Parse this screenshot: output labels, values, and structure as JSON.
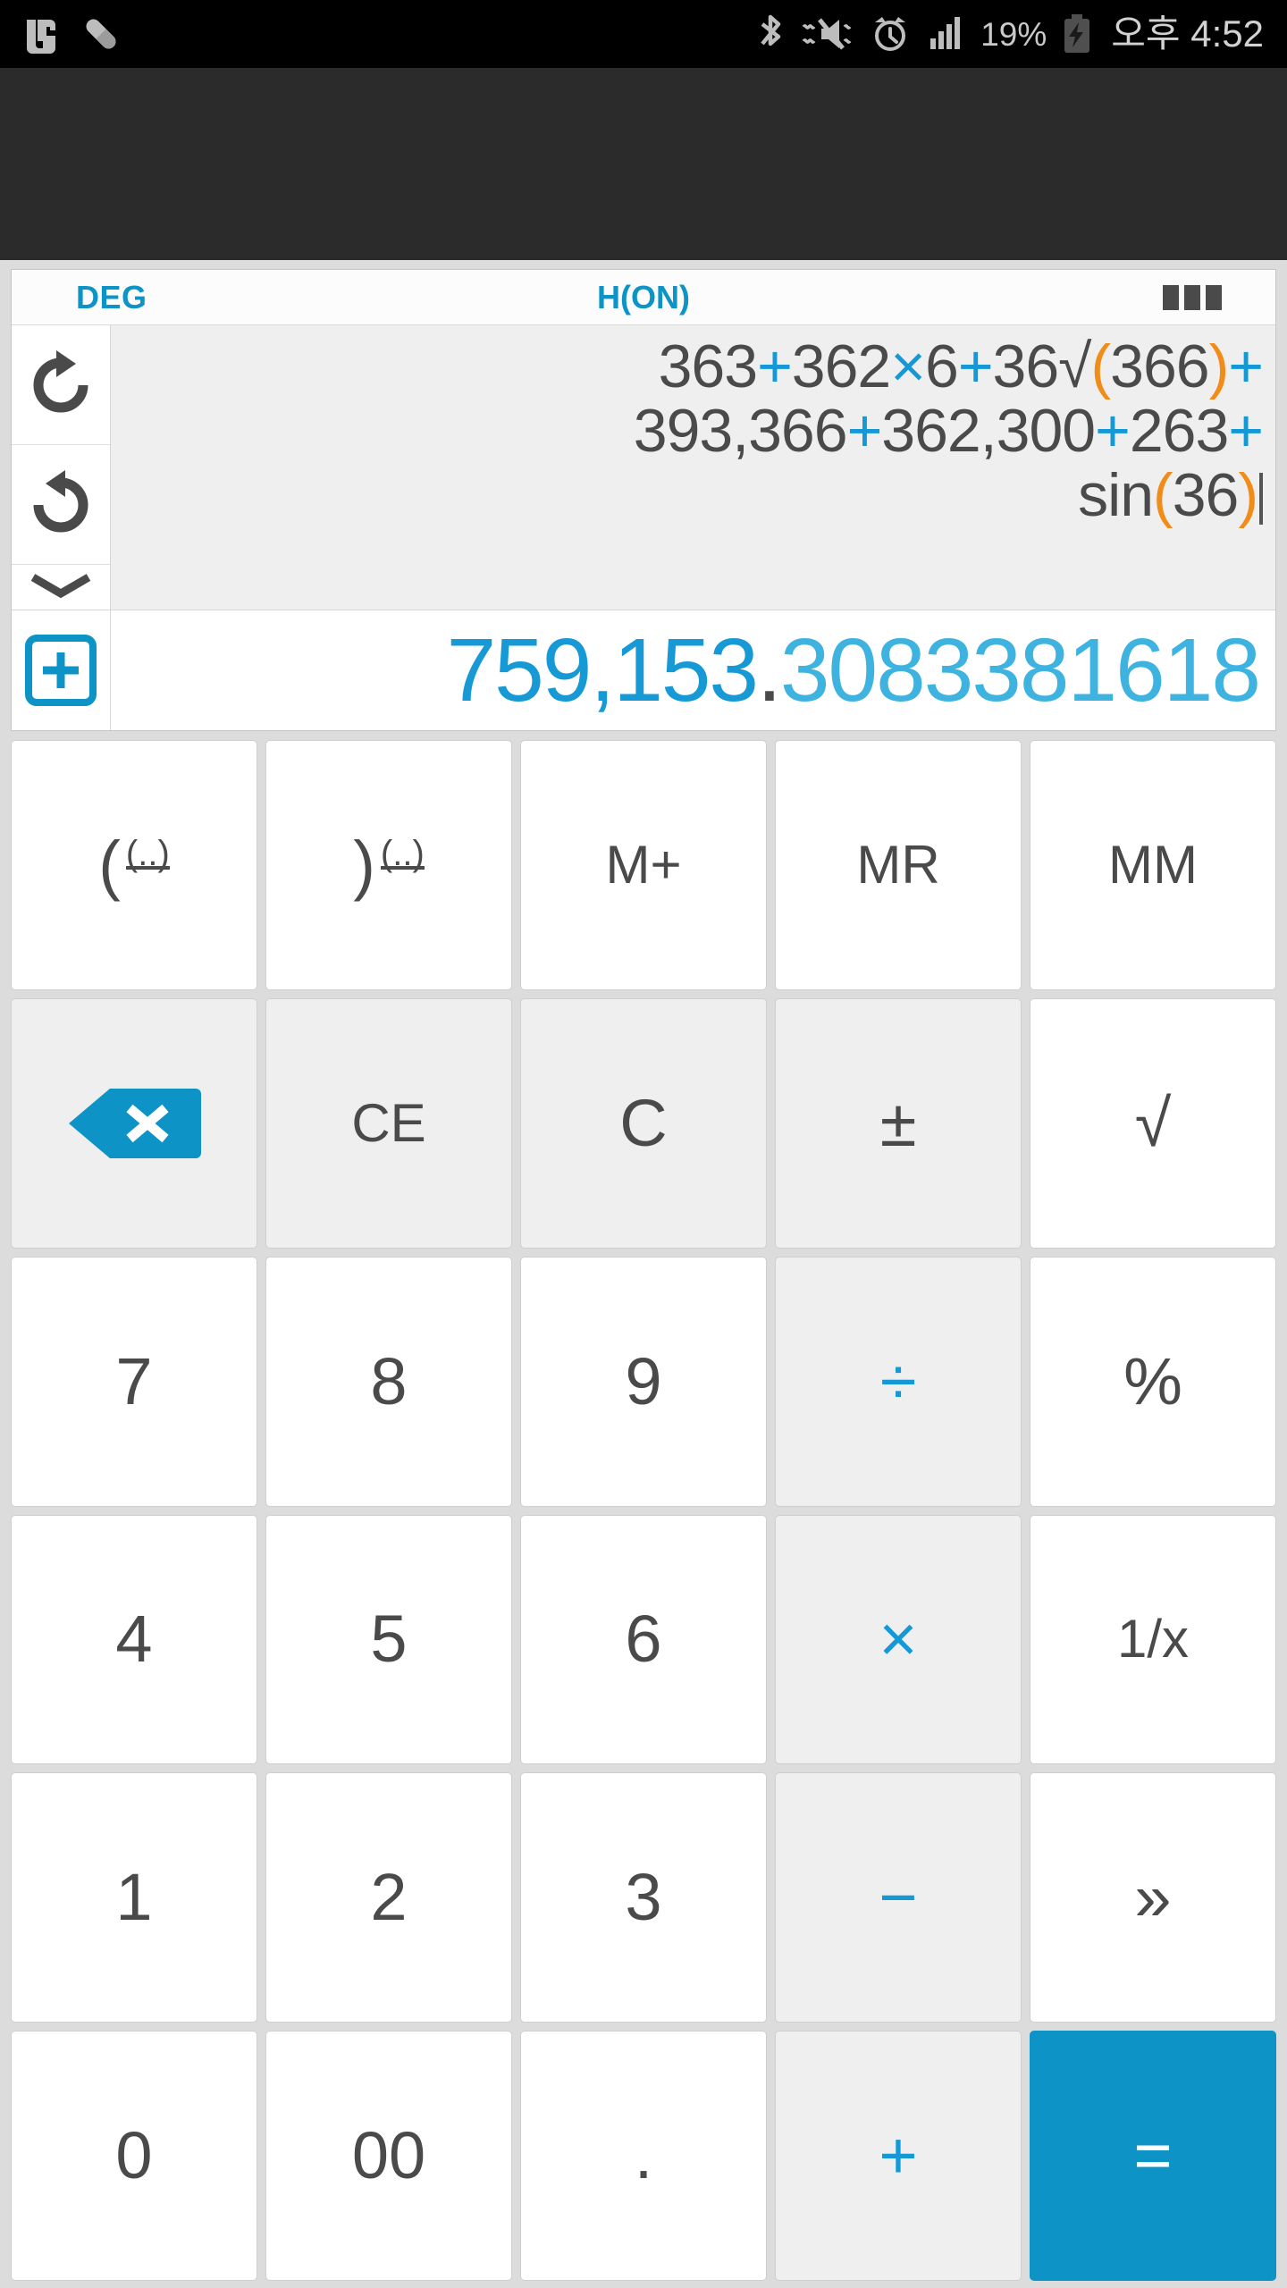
{
  "status_bar": {
    "left_icons": [
      "app-notification-icon",
      "capsule-icon"
    ],
    "right_icons": [
      "bluetooth-icon",
      "vibrate-mute-icon",
      "alarm-icon",
      "signal-bars-icon"
    ],
    "battery_percent": "19%",
    "battery_icon": "battery-charging-icon",
    "clock": "오후 4:52"
  },
  "display": {
    "angle_mode": "DEG",
    "history_mode": "H(ON)",
    "menu_icon": "menu-dots-icon",
    "tools": {
      "redo": "redo-icon",
      "undo": "undo-icon",
      "collapse": "chevron-down-icon"
    },
    "expression_lines": [
      [
        {
          "t": "363",
          "c": "num"
        },
        {
          "t": "+",
          "c": "op"
        },
        {
          "t": "362",
          "c": "num"
        },
        {
          "t": "×",
          "c": "op"
        },
        {
          "t": "6",
          "c": "num"
        },
        {
          "t": "+",
          "c": "op"
        },
        {
          "t": "36",
          "c": "num"
        },
        {
          "t": "√",
          "c": "num"
        },
        {
          "t": "(",
          "c": "paren"
        },
        {
          "t": "366",
          "c": "num"
        },
        {
          "t": ")",
          "c": "paren"
        },
        {
          "t": "+",
          "c": "op"
        }
      ],
      [
        {
          "t": "393,366",
          "c": "num"
        },
        {
          "t": "+",
          "c": "op"
        },
        {
          "t": "362,300",
          "c": "num"
        },
        {
          "t": "+",
          "c": "op"
        },
        {
          "t": "263",
          "c": "num"
        },
        {
          "t": "+",
          "c": "op"
        }
      ],
      [
        {
          "t": "sin",
          "c": "num"
        },
        {
          "t": "(",
          "c": "paren"
        },
        {
          "t": "36",
          "c": "num"
        },
        {
          "t": ")",
          "c": "paren"
        }
      ]
    ],
    "expression_plain": "363+362×6+36√(366)+393,366+362,300+263+sin(36)",
    "memory_button_icon": "memory-plus-boxed-icon",
    "result": {
      "integer_part": "759,153",
      "separator": ".",
      "decimal_part": "3083381618",
      "full": "759,153.3083381618"
    }
  },
  "keypad": {
    "rows": [
      [
        {
          "name": "open-paren",
          "label": "(",
          "style": "white",
          "glyph": "paren-face-open"
        },
        {
          "name": "close-paren",
          "label": ")",
          "style": "white",
          "glyph": "paren-face-close"
        },
        {
          "name": "memory-add",
          "label": "M+",
          "style": "white"
        },
        {
          "name": "memory-recall",
          "label": "MR",
          "style": "white"
        },
        {
          "name": "memory-manager",
          "label": "MM",
          "style": "white"
        }
      ],
      [
        {
          "name": "backspace",
          "label": "",
          "style": "gray",
          "glyph": "backspace-icon"
        },
        {
          "name": "clear-entry",
          "label": "CE",
          "style": "gray"
        },
        {
          "name": "clear-all",
          "label": "C",
          "style": "gray"
        },
        {
          "name": "plus-minus",
          "label": "±",
          "style": "gray"
        },
        {
          "name": "square-root",
          "label": "√",
          "style": "white"
        }
      ],
      [
        {
          "name": "digit-7",
          "label": "7",
          "style": "white"
        },
        {
          "name": "digit-8",
          "label": "8",
          "style": "white"
        },
        {
          "name": "digit-9",
          "label": "9",
          "style": "white"
        },
        {
          "name": "divide",
          "label": "÷",
          "style": "gray-blue"
        },
        {
          "name": "percent",
          "label": "%",
          "style": "white"
        }
      ],
      [
        {
          "name": "digit-4",
          "label": "4",
          "style": "white"
        },
        {
          "name": "digit-5",
          "label": "5",
          "style": "white"
        },
        {
          "name": "digit-6",
          "label": "6",
          "style": "white"
        },
        {
          "name": "multiply",
          "label": "×",
          "style": "gray-blue"
        },
        {
          "name": "reciprocal",
          "label": "1/x",
          "style": "white"
        }
      ],
      [
        {
          "name": "digit-1",
          "label": "1",
          "style": "white"
        },
        {
          "name": "digit-2",
          "label": "2",
          "style": "white"
        },
        {
          "name": "digit-3",
          "label": "3",
          "style": "white"
        },
        {
          "name": "subtract",
          "label": "−",
          "style": "gray-blue"
        },
        {
          "name": "more-functions",
          "label": "»",
          "style": "white"
        }
      ],
      [
        {
          "name": "digit-0",
          "label": "0",
          "style": "white"
        },
        {
          "name": "digit-double-zero",
          "label": "00",
          "style": "white"
        },
        {
          "name": "decimal-point",
          "label": ".",
          "style": "white"
        },
        {
          "name": "add",
          "label": "+",
          "style": "gray-blue"
        },
        {
          "name": "equals",
          "label": "=",
          "style": "accent"
        }
      ]
    ]
  },
  "colors": {
    "accent": "#0d93c6",
    "operator": "#1499d6",
    "paren": "#f28c18",
    "text": "#4a4a4a",
    "key_gray": "#efefef",
    "surface": "#dcdcdc"
  }
}
